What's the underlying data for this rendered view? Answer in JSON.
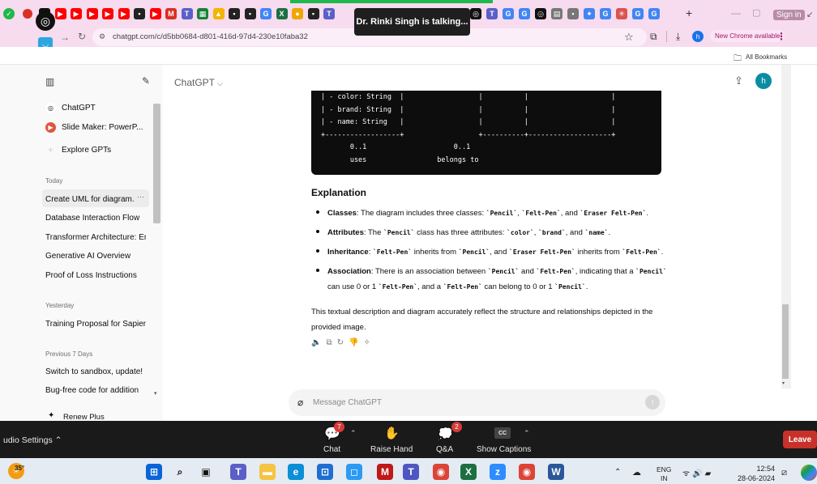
{
  "browser": {
    "url": "chatgpt.com/c/d5bb0684-d801-416d-97d4-230e10faba32",
    "update_label": "New Chrome available",
    "bookmarks_label": "All Bookmarks",
    "signin_label": "Sign in",
    "toast": "Dr. Rinki Singh is talking..."
  },
  "tabs": [
    {
      "icon": "chatgpt-tab-icon",
      "color": "#111111"
    },
    {
      "icon": "youtube-tab-icon",
      "color": "#ff0000",
      "glyph": "▶"
    },
    {
      "icon": "youtube-tab-icon",
      "color": "#ff0000",
      "glyph": "▶"
    },
    {
      "icon": "youtube-tab-icon",
      "color": "#ff0000",
      "glyph": "▶"
    },
    {
      "icon": "youtube-tab-icon",
      "color": "#ff0000",
      "glyph": "▶"
    },
    {
      "icon": "youtube-tab-icon",
      "color": "#ff0000",
      "glyph": "▶"
    },
    {
      "icon": "meet-tab-icon",
      "color": "#222222",
      "glyph": "▪"
    },
    {
      "icon": "youtube-tab-icon",
      "color": "#ff0000",
      "glyph": "▶"
    },
    {
      "icon": "gmail-tab-icon",
      "color": "#d93025",
      "glyph": "M"
    },
    {
      "icon": "teams-tab-icon",
      "color": "#5b5fc7",
      "glyph": "T"
    },
    {
      "icon": "sheets-tab-icon",
      "color": "#188038",
      "glyph": "▦"
    },
    {
      "icon": "drive-tab-icon",
      "color": "#f4b400",
      "glyph": "▲"
    },
    {
      "icon": "meet-tab-icon",
      "color": "#222222",
      "glyph": "▪"
    },
    {
      "icon": "meet-tab-icon",
      "color": "#222222",
      "glyph": "▪"
    },
    {
      "icon": "google-tab-icon",
      "color": "#4285f4",
      "glyph": "G"
    },
    {
      "icon": "excel-tab-icon",
      "color": "#1d6f42",
      "glyph": "X"
    },
    {
      "icon": "notify-tab-icon",
      "color": "#f0a500",
      "glyph": "●"
    },
    {
      "icon": "meet-tab-icon",
      "color": "#222222",
      "glyph": "▪"
    },
    {
      "icon": "teams-tab-icon",
      "color": "#5b5fc7",
      "glyph": "T"
    }
  ],
  "tabs_right": [
    {
      "icon": "chatgpt-tab-icon",
      "color": "#111111",
      "glyph": "◎"
    },
    {
      "icon": "teams-tab-icon",
      "color": "#5b5fc7",
      "glyph": "T"
    },
    {
      "icon": "google-tab-icon",
      "color": "#4285f4",
      "glyph": "G"
    },
    {
      "icon": "google-tab-icon",
      "color": "#4285f4",
      "glyph": "G"
    },
    {
      "icon": "chatgpt-tab-icon",
      "color": "#111111",
      "glyph": "◎"
    },
    {
      "icon": "doc-tab-icon",
      "color": "#777777",
      "glyph": "▤"
    },
    {
      "icon": "doc-tab-icon",
      "color": "#777777",
      "glyph": "▪"
    },
    {
      "icon": "gemini-tab-icon",
      "color": "#4285f4",
      "glyph": "✦"
    },
    {
      "icon": "google-tab-icon",
      "color": "#4285f4",
      "glyph": "G"
    },
    {
      "icon": "asterisk-tab-icon",
      "color": "#d9534f",
      "glyph": "✳"
    },
    {
      "icon": "google-tab-icon",
      "color": "#4285f4",
      "glyph": "G"
    },
    {
      "icon": "google-tab-icon",
      "color": "#4285f4",
      "glyph": "G"
    }
  ],
  "sidebar": {
    "pinned": [
      {
        "label": "ChatGPT",
        "icon": "chatgpt-logo-icon"
      },
      {
        "label": "Slide Maker: PowerP...",
        "icon": "slide-maker-icon"
      },
      {
        "label": "Explore GPTs",
        "icon": "grid-icon"
      }
    ],
    "groups": [
      {
        "heading": "Today",
        "items": [
          "Create UML for diagram.",
          "Database Interaction Flow",
          "Transformer Architecture: Enhan",
          "Generative AI Overview",
          "Proof of Loss Instructions"
        ]
      },
      {
        "heading": "Yesterday",
        "items": [
          "Training Proposal for Sapient"
        ]
      },
      {
        "heading": "Previous 7 Days",
        "items": [
          "Switch to sandbox, update!",
          "Bug-free code for addition"
        ]
      }
    ],
    "active_item_more": "···",
    "renew_label": "Renew Plus"
  },
  "header": {
    "model_label": "ChatGPT",
    "avatar_letter": "h"
  },
  "code_lines": [
    "| - color: String  |                  |          |                    |",
    "| - brand: String  |                  |          |                    |",
    "| - name: String   |                  |          |                    |",
    "+------------------+                  +----------+--------------------+",
    "       0..1                     0..1",
    "       uses                 belongs to"
  ],
  "answer": {
    "heading": "Explanation",
    "bullets": [
      {
        "label": "Classes",
        "parts": [
          ": The diagram includes three classes: ",
          {
            "c": "`Pencil`"
          },
          ", ",
          {
            "c": "`Felt-Pen`"
          },
          ", and ",
          {
            "c": "`Eraser Felt-Pen`"
          },
          "."
        ]
      },
      {
        "label": "Attributes",
        "parts": [
          ": The ",
          {
            "c": "`Pencil`"
          },
          " class has three attributes: ",
          {
            "c": "`color`"
          },
          ", ",
          {
            "c": "`brand`"
          },
          ", and ",
          {
            "c": "`name`"
          },
          "."
        ]
      },
      {
        "label": "Inheritance",
        "parts": [
          ": ",
          {
            "c": "`Felt-Pen`"
          },
          " inherits from ",
          {
            "c": "`Pencil`"
          },
          ", and ",
          {
            "c": "`Eraser Felt-Pen`"
          },
          " inherits from ",
          {
            "c": "`Felt-Pen`"
          },
          "."
        ]
      },
      {
        "label": "Association",
        "parts": [
          ": There is an association between ",
          {
            "c": "`Pencil`"
          },
          " and ",
          {
            "c": "`Felt-Pen`"
          },
          ", indicating that a ",
          {
            "c": "`Pencil`"
          },
          " can use 0 or 1 ",
          {
            "c": "`Felt-Pen`"
          },
          ", and a ",
          {
            "c": "`Felt-Pen`"
          },
          " can belong to 0 or 1 ",
          {
            "c": "`Pencil`"
          },
          "."
        ]
      }
    ],
    "summary": "This textual description and diagram accurately reflect the structure and relationships depicted in the provided image."
  },
  "composer": {
    "placeholder": "Message ChatGPT"
  },
  "meeting": {
    "audio_settings": "udio Settings",
    "chat_label": "Chat",
    "chat_badge": "7",
    "raise_hand_label": "Raise Hand",
    "qa_label": "Q&A",
    "qa_badge": "2",
    "captions_label": "Show Captions",
    "captions_glyph": "CC",
    "leave_label": "Leave"
  },
  "taskbar": {
    "temperature": "35°",
    "lang_line1": "ENG",
    "lang_line2": "IN",
    "time": "12:54",
    "date": "28-06-2024"
  }
}
